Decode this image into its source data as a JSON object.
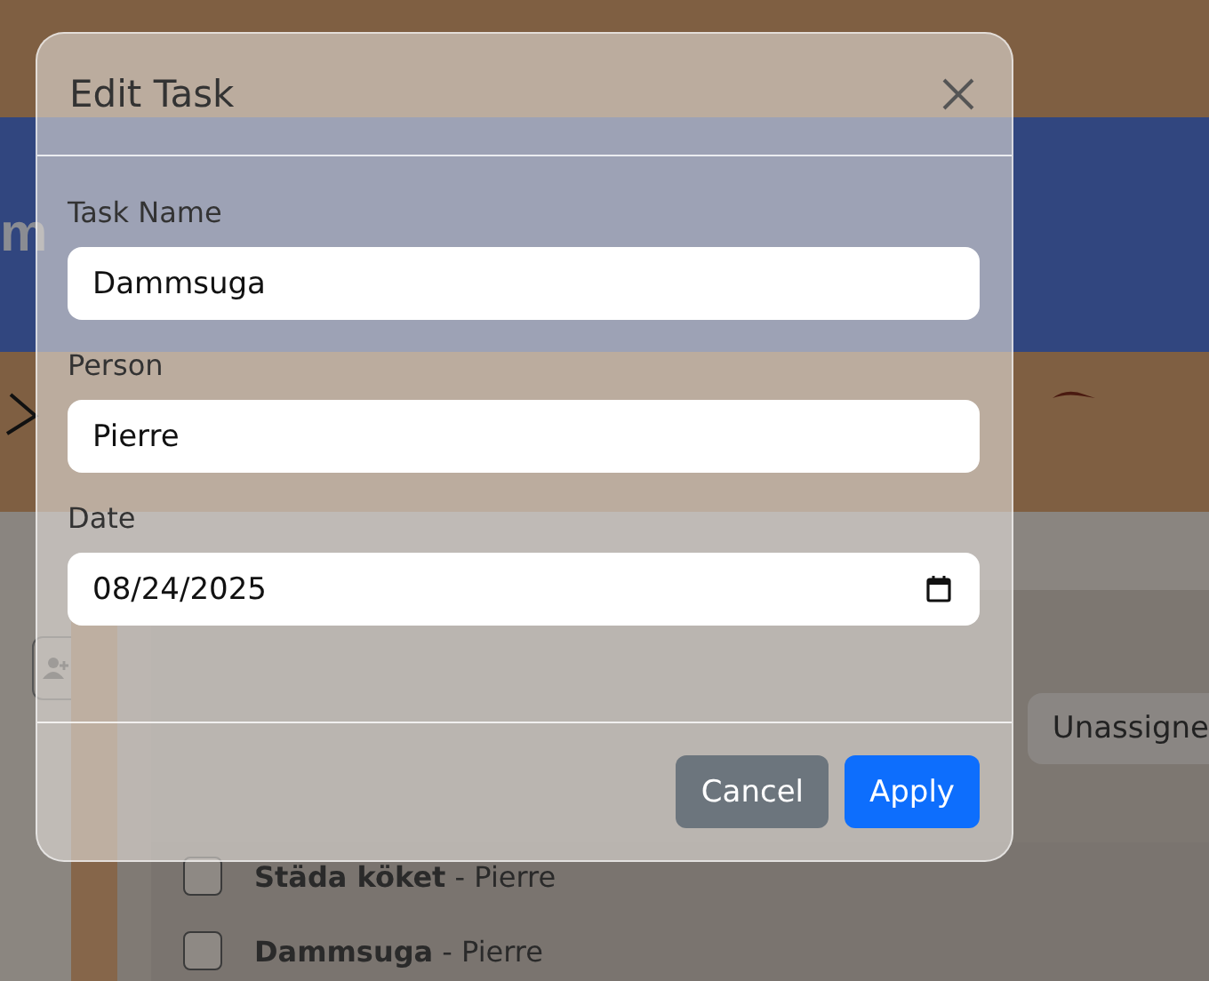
{
  "page": {
    "title_fragment": "m",
    "filter_button": "Unassigne",
    "tasks": [
      {
        "text": "**Städa köket** - Pierre",
        "checked": false
      },
      {
        "text": "**Dammsuga** - Pierre",
        "checked": false
      }
    ]
  },
  "dialog": {
    "title": "Edit Task",
    "fields": [
      {
        "label": "Task Name",
        "value": "Dammsuga",
        "kind": "text"
      },
      {
        "label": "Person",
        "value": "Pierre",
        "kind": "text"
      },
      {
        "label": "Date",
        "value": "08/24/2025",
        "kind": "date"
      }
    ],
    "buttons": [
      {
        "label": "Cancel",
        "kind": "secondary"
      },
      {
        "label": "Apply",
        "kind": "primary"
      }
    ]
  }
}
